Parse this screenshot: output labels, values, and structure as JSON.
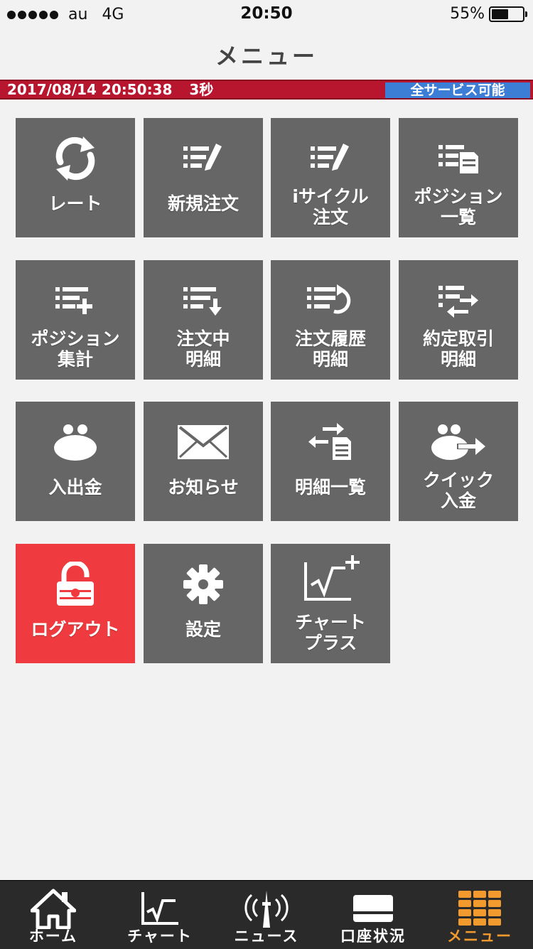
{
  "status": {
    "carrier": "au",
    "network": "4G",
    "time": "20:50",
    "battery": "55%",
    "battery_level": 0.55
  },
  "nav": {
    "title": "メニュー"
  },
  "info": {
    "datetime": "2017/08/14 20:50:38",
    "interval": "3秒",
    "service": "全サービス可能"
  },
  "colors": {
    "accent_red": "#b8162f",
    "tile": "#666666",
    "logout": "#ef3b3f",
    "service_blue": "#3c7ed6",
    "tab_active": "#f39a2e"
  },
  "tiles": [
    {
      "label": "レート",
      "icon": "refresh-icon"
    },
    {
      "label": "新規注文",
      "icon": "order-list-icon"
    },
    {
      "label": "iサイクル\n注文",
      "icon": "order-list-icon"
    },
    {
      "label": "ポジション\n一覧",
      "icon": "list-document-icon"
    },
    {
      "label": "ポジション\n集計",
      "icon": "list-plus-icon"
    },
    {
      "label": "注文中\n明細",
      "icon": "list-down-arrow-icon"
    },
    {
      "label": "注文履歴\n明細",
      "icon": "list-history-icon"
    },
    {
      "label": "約定取引\n明細",
      "icon": "list-exchange-icon"
    },
    {
      "label": "入出金",
      "icon": "purse-icon"
    },
    {
      "label": "お知らせ",
      "icon": "envelope-icon"
    },
    {
      "label": "明細一覧",
      "icon": "exchange-document-icon"
    },
    {
      "label": "クイック\n入金",
      "icon": "purse-arrow-icon"
    },
    {
      "label": "ログアウト",
      "icon": "padlock-icon"
    },
    {
      "label": "設定",
      "icon": "gear-icon"
    },
    {
      "label": "チャート\nプラス",
      "icon": "chart-plus-icon"
    }
  ],
  "tabs": [
    {
      "label": "ホーム",
      "icon": "home-icon"
    },
    {
      "label": "チャート",
      "icon": "chart-icon"
    },
    {
      "label": "ニュース",
      "icon": "broadcast-tower-icon"
    },
    {
      "label": "口座状況",
      "icon": "card-icon"
    },
    {
      "label": "メニュー",
      "icon": "grid-menu-icon",
      "active": true
    }
  ]
}
